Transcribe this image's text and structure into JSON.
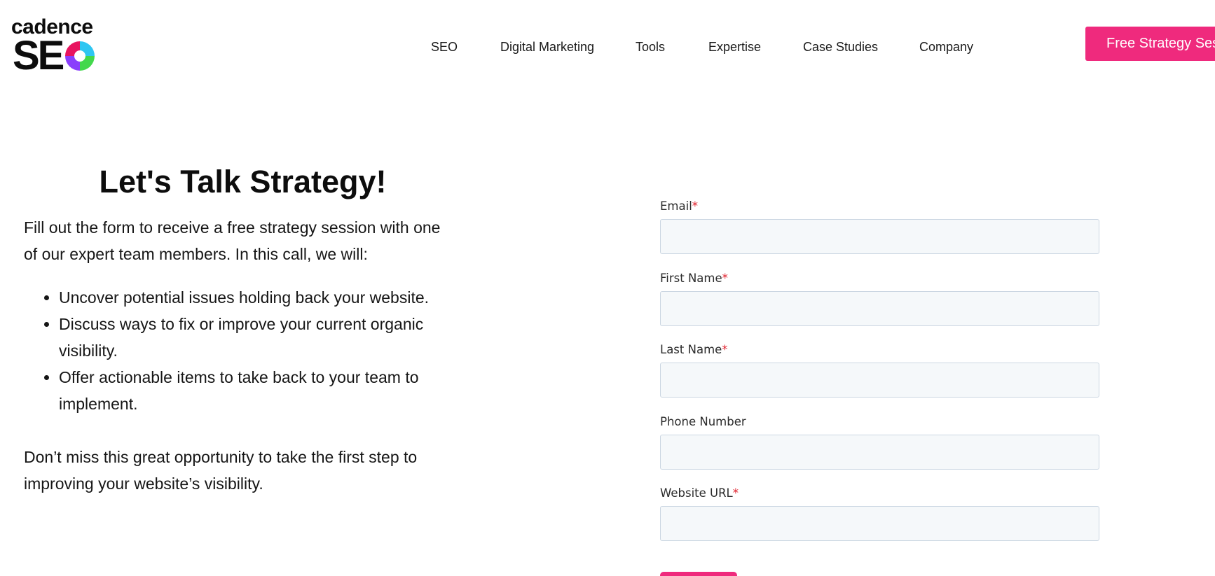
{
  "brand": {
    "wordmark_top": "cadence",
    "wordmark_bottom": "SE",
    "colors": {
      "pink": "#ef2a7d",
      "purple": "#8a3ffc",
      "green": "#43d84c",
      "cyan": "#2ec6f2",
      "magenta": "#e8145f"
    }
  },
  "nav": {
    "items": [
      {
        "label": "SEO"
      },
      {
        "label": "Digital Marketing"
      },
      {
        "label": "Tools"
      },
      {
        "label": "Expertise"
      },
      {
        "label": "Case Studies"
      },
      {
        "label": "Company"
      }
    ],
    "cta_label": "Free Strategy Session"
  },
  "intro": {
    "title": "Let's Talk Strategy!",
    "lead_line1": "Fill out the form to receive a free strategy session with one",
    "lead_line2": "of our expert team members. In this call, we will:",
    "bullets": [
      {
        "text": "Uncover potential issues holding back your website."
      },
      {
        "text": "Discuss ways to fix or improve your current organic visibility."
      },
      {
        "text": "Offer actionable items to take back to your team to implement."
      }
    ],
    "closing_line1": "Don’t miss this great opportunity to take the first step to",
    "closing_line2": "improving your website’s visibility."
  },
  "form": {
    "fields": [
      {
        "label": "Email",
        "required_mark": "*",
        "value": ""
      },
      {
        "label": "First Name",
        "required_mark": "*",
        "value": ""
      },
      {
        "label": "Last Name",
        "required_mark": "*",
        "value": ""
      },
      {
        "label": "Phone Number",
        "required_mark": "",
        "value": ""
      },
      {
        "label": "Website URL",
        "required_mark": "*",
        "value": ""
      }
    ]
  }
}
